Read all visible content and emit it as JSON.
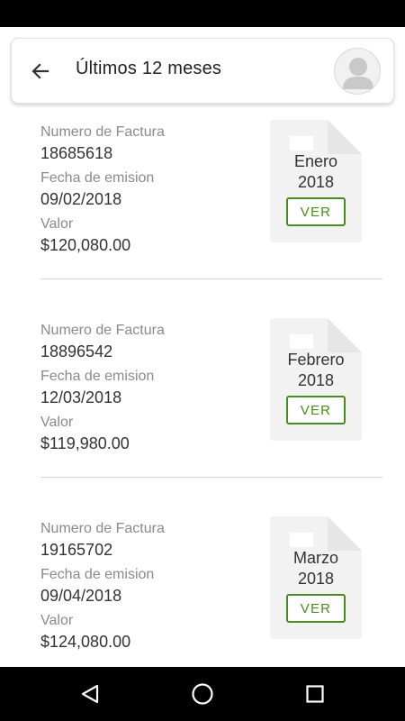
{
  "header": {
    "title": "Últimos 12 meses",
    "back_icon": "arrow-left-icon",
    "avatar_icon": "user-avatar-icon"
  },
  "invoices": [
    {
      "number_label": "Numero de Factura",
      "number": "18685618",
      "date_label": "Fecha de emision",
      "date": "09/02/2018",
      "value_label": "Valor",
      "value": "$120,080.00",
      "month": "Enero",
      "year": "2018",
      "button_label": "VER"
    },
    {
      "number_label": "Numero de Factura",
      "number": "18896542",
      "date_label": "Fecha de emision",
      "date": "12/03/2018",
      "value_label": "Valor",
      "value": "$119,980.00",
      "month": "Febrero",
      "year": "2018",
      "button_label": "VER"
    },
    {
      "number_label": "Numero de Factura",
      "number": "19165702",
      "date_label": "Fecha de emision",
      "date": "09/04/2018",
      "value_label": "Valor",
      "value": "$124,080.00",
      "month": "Marzo",
      "year": "2018",
      "button_label": "VER"
    }
  ],
  "colors": {
    "accent": "#4a8a1e",
    "doc_bg": "#f2f2f2",
    "text_muted": "#8a8a8a",
    "text_main": "#333333"
  },
  "nav": {
    "back_icon": "triangle-back-icon",
    "home_icon": "circle-home-icon",
    "recents_icon": "square-recents-icon"
  }
}
